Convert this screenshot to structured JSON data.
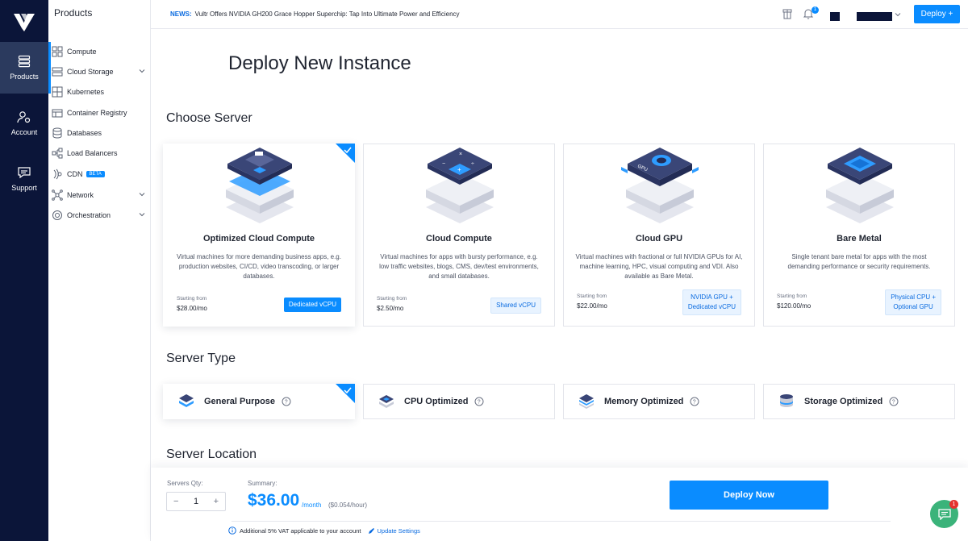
{
  "rail": {
    "items": [
      {
        "label": "Products",
        "icon": "server-stack-icon"
      },
      {
        "label": "Account",
        "icon": "user-gear-icon"
      },
      {
        "label": "Support",
        "icon": "chat-bubble-icon"
      }
    ]
  },
  "subnav": {
    "title": "Products",
    "items": [
      {
        "label": "Compute",
        "icon": "compute-icon"
      },
      {
        "label": "Cloud Storage",
        "icon": "storage-icon",
        "expandable": true
      },
      {
        "label": "Kubernetes",
        "icon": "kubernetes-icon"
      },
      {
        "label": "Container Registry",
        "icon": "registry-icon"
      },
      {
        "label": "Databases",
        "icon": "database-icon"
      },
      {
        "label": "Load Balancers",
        "icon": "load-balancer-icon"
      },
      {
        "label": "CDN",
        "icon": "cdn-icon",
        "badge": "BETA"
      },
      {
        "label": "Network",
        "icon": "network-icon",
        "expandable": true
      },
      {
        "label": "Orchestration",
        "icon": "orchestration-icon",
        "expandable": true
      }
    ]
  },
  "topbar": {
    "news_label": "NEWS:",
    "news_text": "Vultr Offers NVIDIA GH200 Grace Hopper Superchip: Tap Into Ultimate Power and Efficiency",
    "notification_count": "1",
    "deploy_label": "Deploy +"
  },
  "page": {
    "title": "Deploy New Instance",
    "choose_server_heading": "Choose Server",
    "server_type_heading": "Server Type",
    "server_location_heading": "Server Location"
  },
  "servers": [
    {
      "title": "Optimized Cloud Compute",
      "desc": "Virtual machines for more demanding business apps, e.g. production websites, CI/CD, video transcoding, or larger databases.",
      "starting": "Starting from",
      "price": "$28.00/mo",
      "tag": "Dedicated vCPU",
      "selected": true
    },
    {
      "title": "Cloud Compute",
      "desc": "Virtual machines for apps with bursty performance, e.g. low traffic websites, blogs, CMS, dev/test environments, and small databases.",
      "starting": "Starting from",
      "price": "$2.50/mo",
      "tag": "Shared vCPU",
      "selected": false
    },
    {
      "title": "Cloud GPU",
      "desc": "Virtual machines with fractional or full NVIDIA GPUs for AI, machine learning, HPC, visual computing and VDI. Also available as Bare Metal.",
      "starting": "Starting from",
      "price": "$22.00/mo",
      "tag_line1": "NVIDIA GPU +",
      "tag_line2": "Dedicated vCPU",
      "selected": false
    },
    {
      "title": "Bare Metal",
      "desc": "Single tenant bare metal for apps with the most demanding performance or security requirements.",
      "starting": "Starting from",
      "price": "$120.00/mo",
      "tag_line1": "Physical CPU +",
      "tag_line2": "Optional GPU",
      "selected": false
    }
  ],
  "server_types": [
    {
      "label": "General Purpose",
      "selected": true
    },
    {
      "label": "CPU Optimized",
      "selected": false
    },
    {
      "label": "Memory Optimized",
      "selected": false
    },
    {
      "label": "Storage Optimized",
      "selected": false
    }
  ],
  "summary": {
    "qty_label": "Servers Qty:",
    "qty_value": "1",
    "minus": "−",
    "plus": "+",
    "summary_label": "Summary:",
    "price": "$36.00",
    "per_month": "/month",
    "per_hour": "($0.054/hour)",
    "deploy_now": "Deploy Now",
    "vat_text": "Additional 5% VAT applicable to your account",
    "update_settings": "Update Settings"
  },
  "chat": {
    "badge": "1"
  },
  "colors": {
    "accent": "#0a8cff",
    "rail": "#0b1539",
    "chat": "#3bb37a",
    "badge_red": "#e5322d"
  }
}
